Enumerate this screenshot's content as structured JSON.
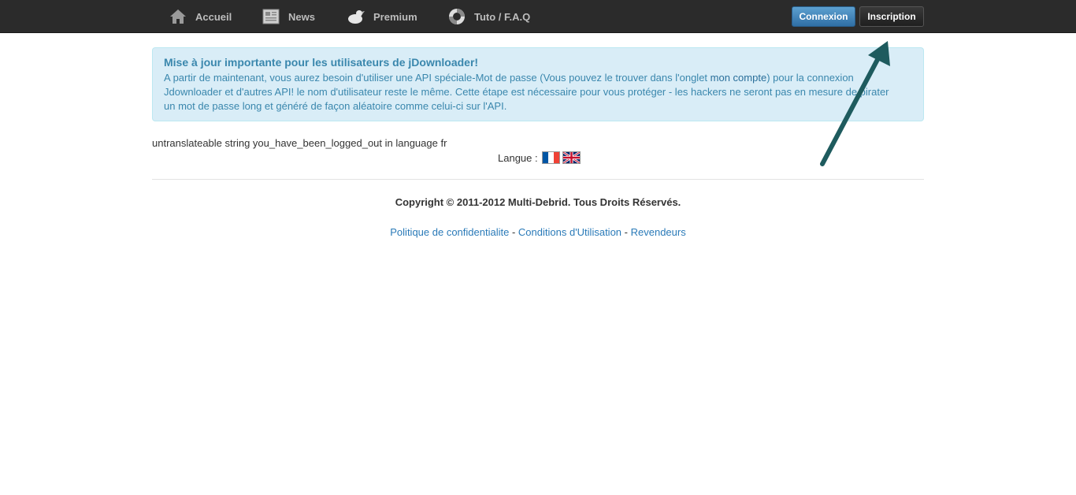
{
  "nav": {
    "items": [
      {
        "label": "Accueil",
        "icon": "home-icon"
      },
      {
        "label": "News",
        "icon": "newspaper-icon"
      },
      {
        "label": "Premium",
        "icon": "premium-icon"
      },
      {
        "label": "Tuto / F.A.Q",
        "icon": "lifebuoy-icon"
      }
    ],
    "login_label": "Connexion",
    "register_label": "Inscription"
  },
  "alert": {
    "title": "Mise à jour importante pour les utilisateurs de jDownloader!",
    "line1_pre": "A partir de maintenant, vous aurez besoin d'utiliser une API spéciale-Mot de passe (Vous pouvez le trouver dans l'onglet ",
    "line1_em": "mon compte",
    "line1_post": ") pour la connexion",
    "line2": "Jdownloader et d'autres API! le nom d'utilisateur reste le même. Cette étape est nécessaire pour vous protéger - les hackers ne seront pas en mesure de pirater",
    "line3": "un mot de passe long et généré de façon aléatoire comme celui-ci sur l'API."
  },
  "logout_message": "untranslateable string you_have_been_logged_out in language fr",
  "language": {
    "label": "Langue :",
    "flags": [
      "flag-fr-icon",
      "flag-uk-icon"
    ]
  },
  "footer": {
    "copyright": "Copyright © 2011-2012 Multi-Debrid. Tous Droits Réservés.",
    "links": [
      "Politique de confidentialite",
      "Conditions d'Utilisation",
      "Revendeurs"
    ],
    "separator": "-"
  },
  "colors": {
    "navbar": "#2b2b2b",
    "alert_bg": "#d9edf7",
    "alert_text": "#3a87ad",
    "link": "#2a7ab8",
    "annotation_arrow": "#1e5b5e"
  }
}
